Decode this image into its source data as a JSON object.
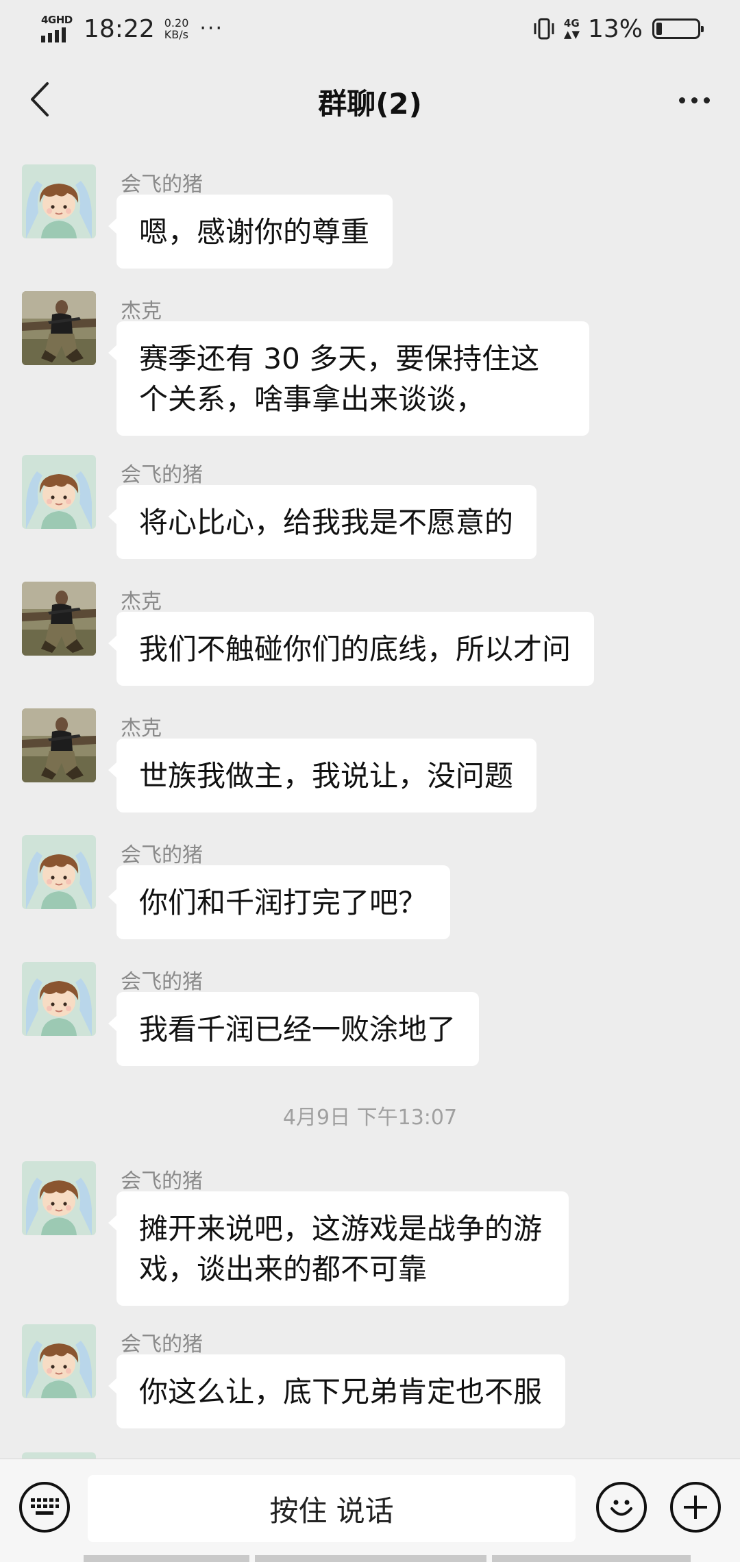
{
  "status_bar": {
    "network_label": "4GHD",
    "time": "18:22",
    "speed_value": "0.20",
    "speed_unit": "KB/s",
    "overflow": "···",
    "network_4g": "4G",
    "battery_percent": "13%",
    "battery_level": 0.13
  },
  "header": {
    "title": "群聊(2)"
  },
  "messages": [
    {
      "sender": "会飞的猪",
      "avatar": "cartoon-avatar",
      "text": "嗯，感谢你的尊重"
    },
    {
      "sender": "杰克",
      "avatar": "photo-avatar",
      "text": "赛季还有 30 多天，要保持住这个关系，啥事拿出来谈谈，"
    },
    {
      "sender": "会飞的猪",
      "avatar": "cartoon-avatar",
      "text": "将心比心，给我我是不愿意的"
    },
    {
      "sender": "杰克",
      "avatar": "photo-avatar",
      "text": "我们不触碰你们的底线，所以才问"
    },
    {
      "sender": "杰克",
      "avatar": "photo-avatar",
      "text": "世族我做主，我说让，没问题"
    },
    {
      "sender": "会飞的猪",
      "avatar": "cartoon-avatar",
      "text": "你们和千润打完了吧？"
    },
    {
      "sender": "会飞的猪",
      "avatar": "cartoon-avatar",
      "text": "我看千润已经一败涂地了"
    },
    {
      "sender": "会飞的猪",
      "avatar": "cartoon-avatar",
      "text": "摊开来说吧，这游戏是战争的游戏，谈出来的都不可靠"
    },
    {
      "sender": "会飞的猪",
      "avatar": "cartoon-avatar",
      "text": "你这么让，底下兄弟肯定也不服"
    }
  ],
  "timestamp_divider": "4月9日 下午13:07",
  "input_bar": {
    "hold_to_talk_label": "按住 说话",
    "icons": [
      "keyboard-icon",
      "emoji-icon",
      "plus-icon"
    ]
  }
}
